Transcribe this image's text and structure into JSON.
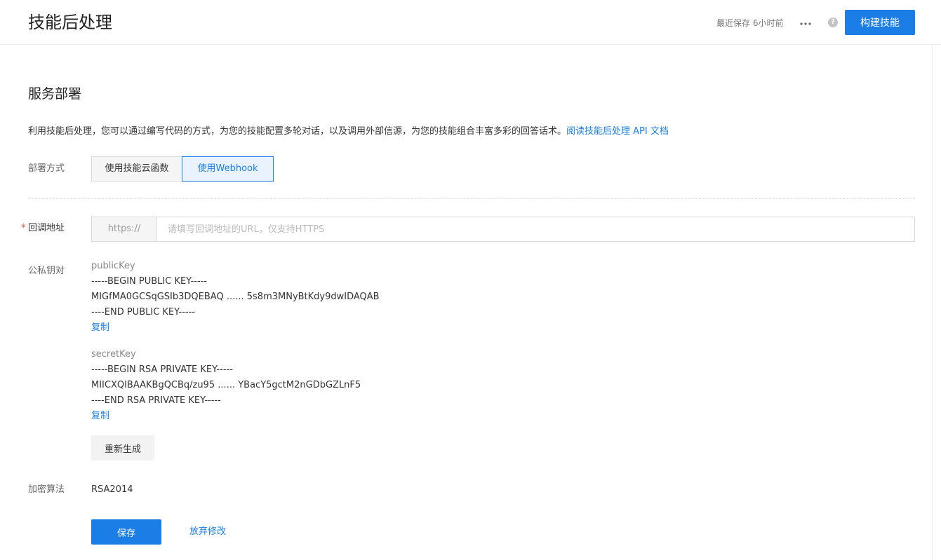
{
  "header": {
    "title": "技能后处理",
    "save_status": "最近保存 6小时前",
    "more_icon": "more-horizontal-icon",
    "help_icon": "question-circle-icon",
    "help_glyph": "?",
    "build_label": "构建技能"
  },
  "section": {
    "title": "服务部署",
    "description": "利用技能后处理，您可以通过编写代码的方式，为您的技能配置多轮对话，以及调用外部信源，为您的技能组合丰富多彩的回答话术。",
    "doc_link": "阅读技能后处理 API 文档"
  },
  "deploy": {
    "label": "部署方式",
    "options": [
      "使用技能云函数",
      "使用Webhook"
    ],
    "selected": "使用Webhook"
  },
  "callback": {
    "required_mark": "*",
    "label": "回调地址",
    "prefix": "https://",
    "placeholder": "请填写回调地址的URL，仅支持HTTPS",
    "value": ""
  },
  "keys": {
    "label": "公私钥对",
    "public": {
      "title": "publicKey",
      "lines": [
        "-----BEGIN PUBLIC KEY-----",
        "MIGfMA0GCSqGSIb3DQEBAQ ...... 5s8m3MNyBtKdy9dwIDAQAB",
        "----END PUBLIC KEY-----"
      ],
      "copy": "复制"
    },
    "secret": {
      "title": "secretKey",
      "lines": [
        "-----BEGIN RSA PRIVATE KEY-----",
        "MIICXQIBAAKBgQCBq/zu95 ...... YBacY5gctM2nGDbGZLnF5",
        "----END RSA PRIVATE KEY-----"
      ],
      "copy": "复制"
    },
    "regenerate": "重新生成"
  },
  "algorithm": {
    "label": "加密算法",
    "value": "RSA2014"
  },
  "actions": {
    "save": "保存",
    "discard": "放弃修改"
  },
  "colors": {
    "accent": "#1a7ee6",
    "required": "#e84a4a"
  }
}
